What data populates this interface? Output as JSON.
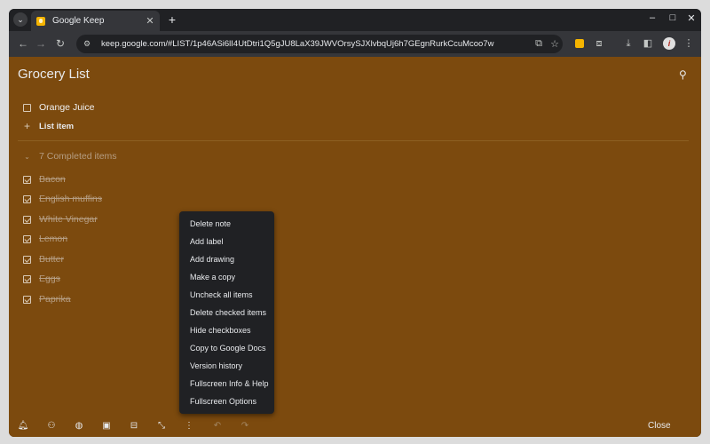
{
  "browser": {
    "tab_title": "Google Keep",
    "url": "keep.google.com/#LIST/1p46ASi6lI4UtDtri1Q5gJU8LaX39JWVOrsySJXlvbqUj6h7GEgnRurkCcuMcoo7w"
  },
  "note": {
    "title": "Grocery List",
    "background_color": "#7c4a0e",
    "unchecked_items": [
      "Orange Juice"
    ],
    "add_item_label": "List item",
    "completed_header": "7 Completed items",
    "completed_items": [
      "Bacon",
      "English muffins",
      "White Vinegar",
      "Lemon",
      "Butter",
      "Eggs",
      "Paprika"
    ]
  },
  "toolbar": {
    "icons": [
      "remind-icon",
      "collaborator-icon",
      "palette-icon",
      "image-icon",
      "archive-icon",
      "fullscreen-exit-icon",
      "more-icon",
      "undo-icon",
      "redo-icon"
    ],
    "close_label": "Close"
  },
  "menu": {
    "items": [
      "Delete note",
      "Add label",
      "Add drawing",
      "Make a copy",
      "Uncheck all items",
      "Delete checked items",
      "Hide checkboxes",
      "Copy to Google Docs",
      "Version history",
      "Fullscreen Info & Help",
      "Fullscreen Options"
    ]
  }
}
